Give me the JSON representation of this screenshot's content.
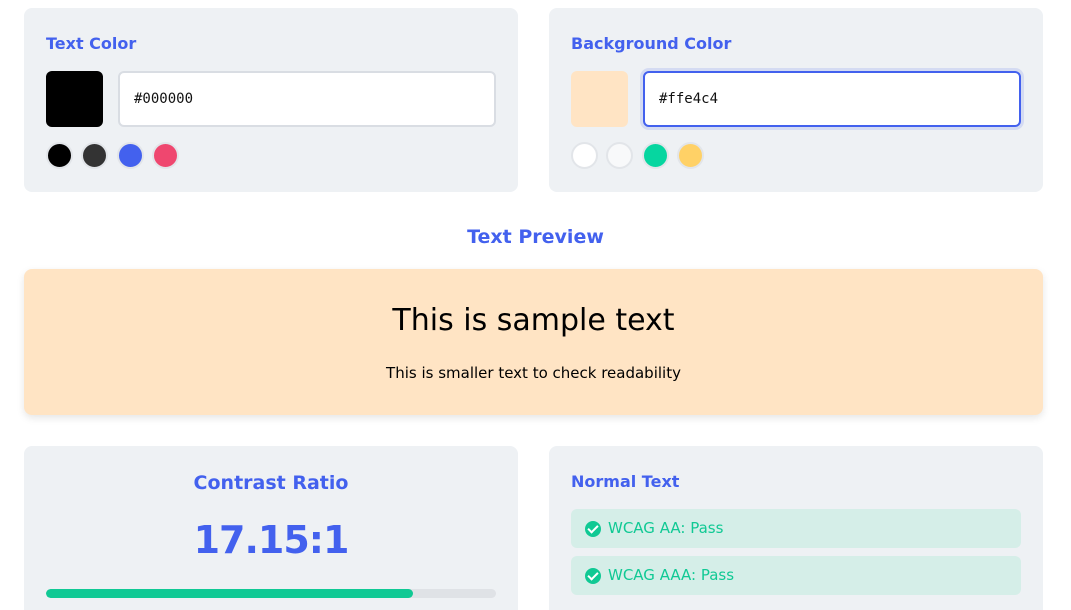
{
  "text_color": {
    "title": "Text Color",
    "value": "#000000",
    "swatch_color": "#000000",
    "presets": [
      {
        "name": "black",
        "color": "#000000"
      },
      {
        "name": "dark-gray",
        "color": "#333333"
      },
      {
        "name": "blue",
        "color": "#4361ee"
      },
      {
        "name": "pink",
        "color": "#ef476f"
      }
    ]
  },
  "background_color": {
    "title": "Background Color",
    "value": "#ffe4c4",
    "swatch_color": "#ffe4c4",
    "presets": [
      {
        "name": "white",
        "color": "#ffffff"
      },
      {
        "name": "off-white",
        "color": "#f8f9fa"
      },
      {
        "name": "green",
        "color": "#06d6a0"
      },
      {
        "name": "yellow",
        "color": "#ffd166"
      }
    ]
  },
  "preview": {
    "title": "Text Preview",
    "large_text": "This is sample text",
    "small_text": "This is smaller text to check readability",
    "text_color": "#000000",
    "background_color": "#ffe4c4"
  },
  "contrast": {
    "title": "Contrast Ratio",
    "value": "17.15:1",
    "bar_fraction": 0.815
  },
  "normal_text": {
    "title": "Normal Text",
    "results": [
      {
        "label": "WCAG AA: Pass",
        "status": "pass"
      },
      {
        "label": "WCAG AAA: Pass",
        "status": "pass"
      }
    ]
  },
  "colors": {
    "accent": "#4361ee",
    "success": "#10c994",
    "panel_bg": "#eef1f4"
  }
}
